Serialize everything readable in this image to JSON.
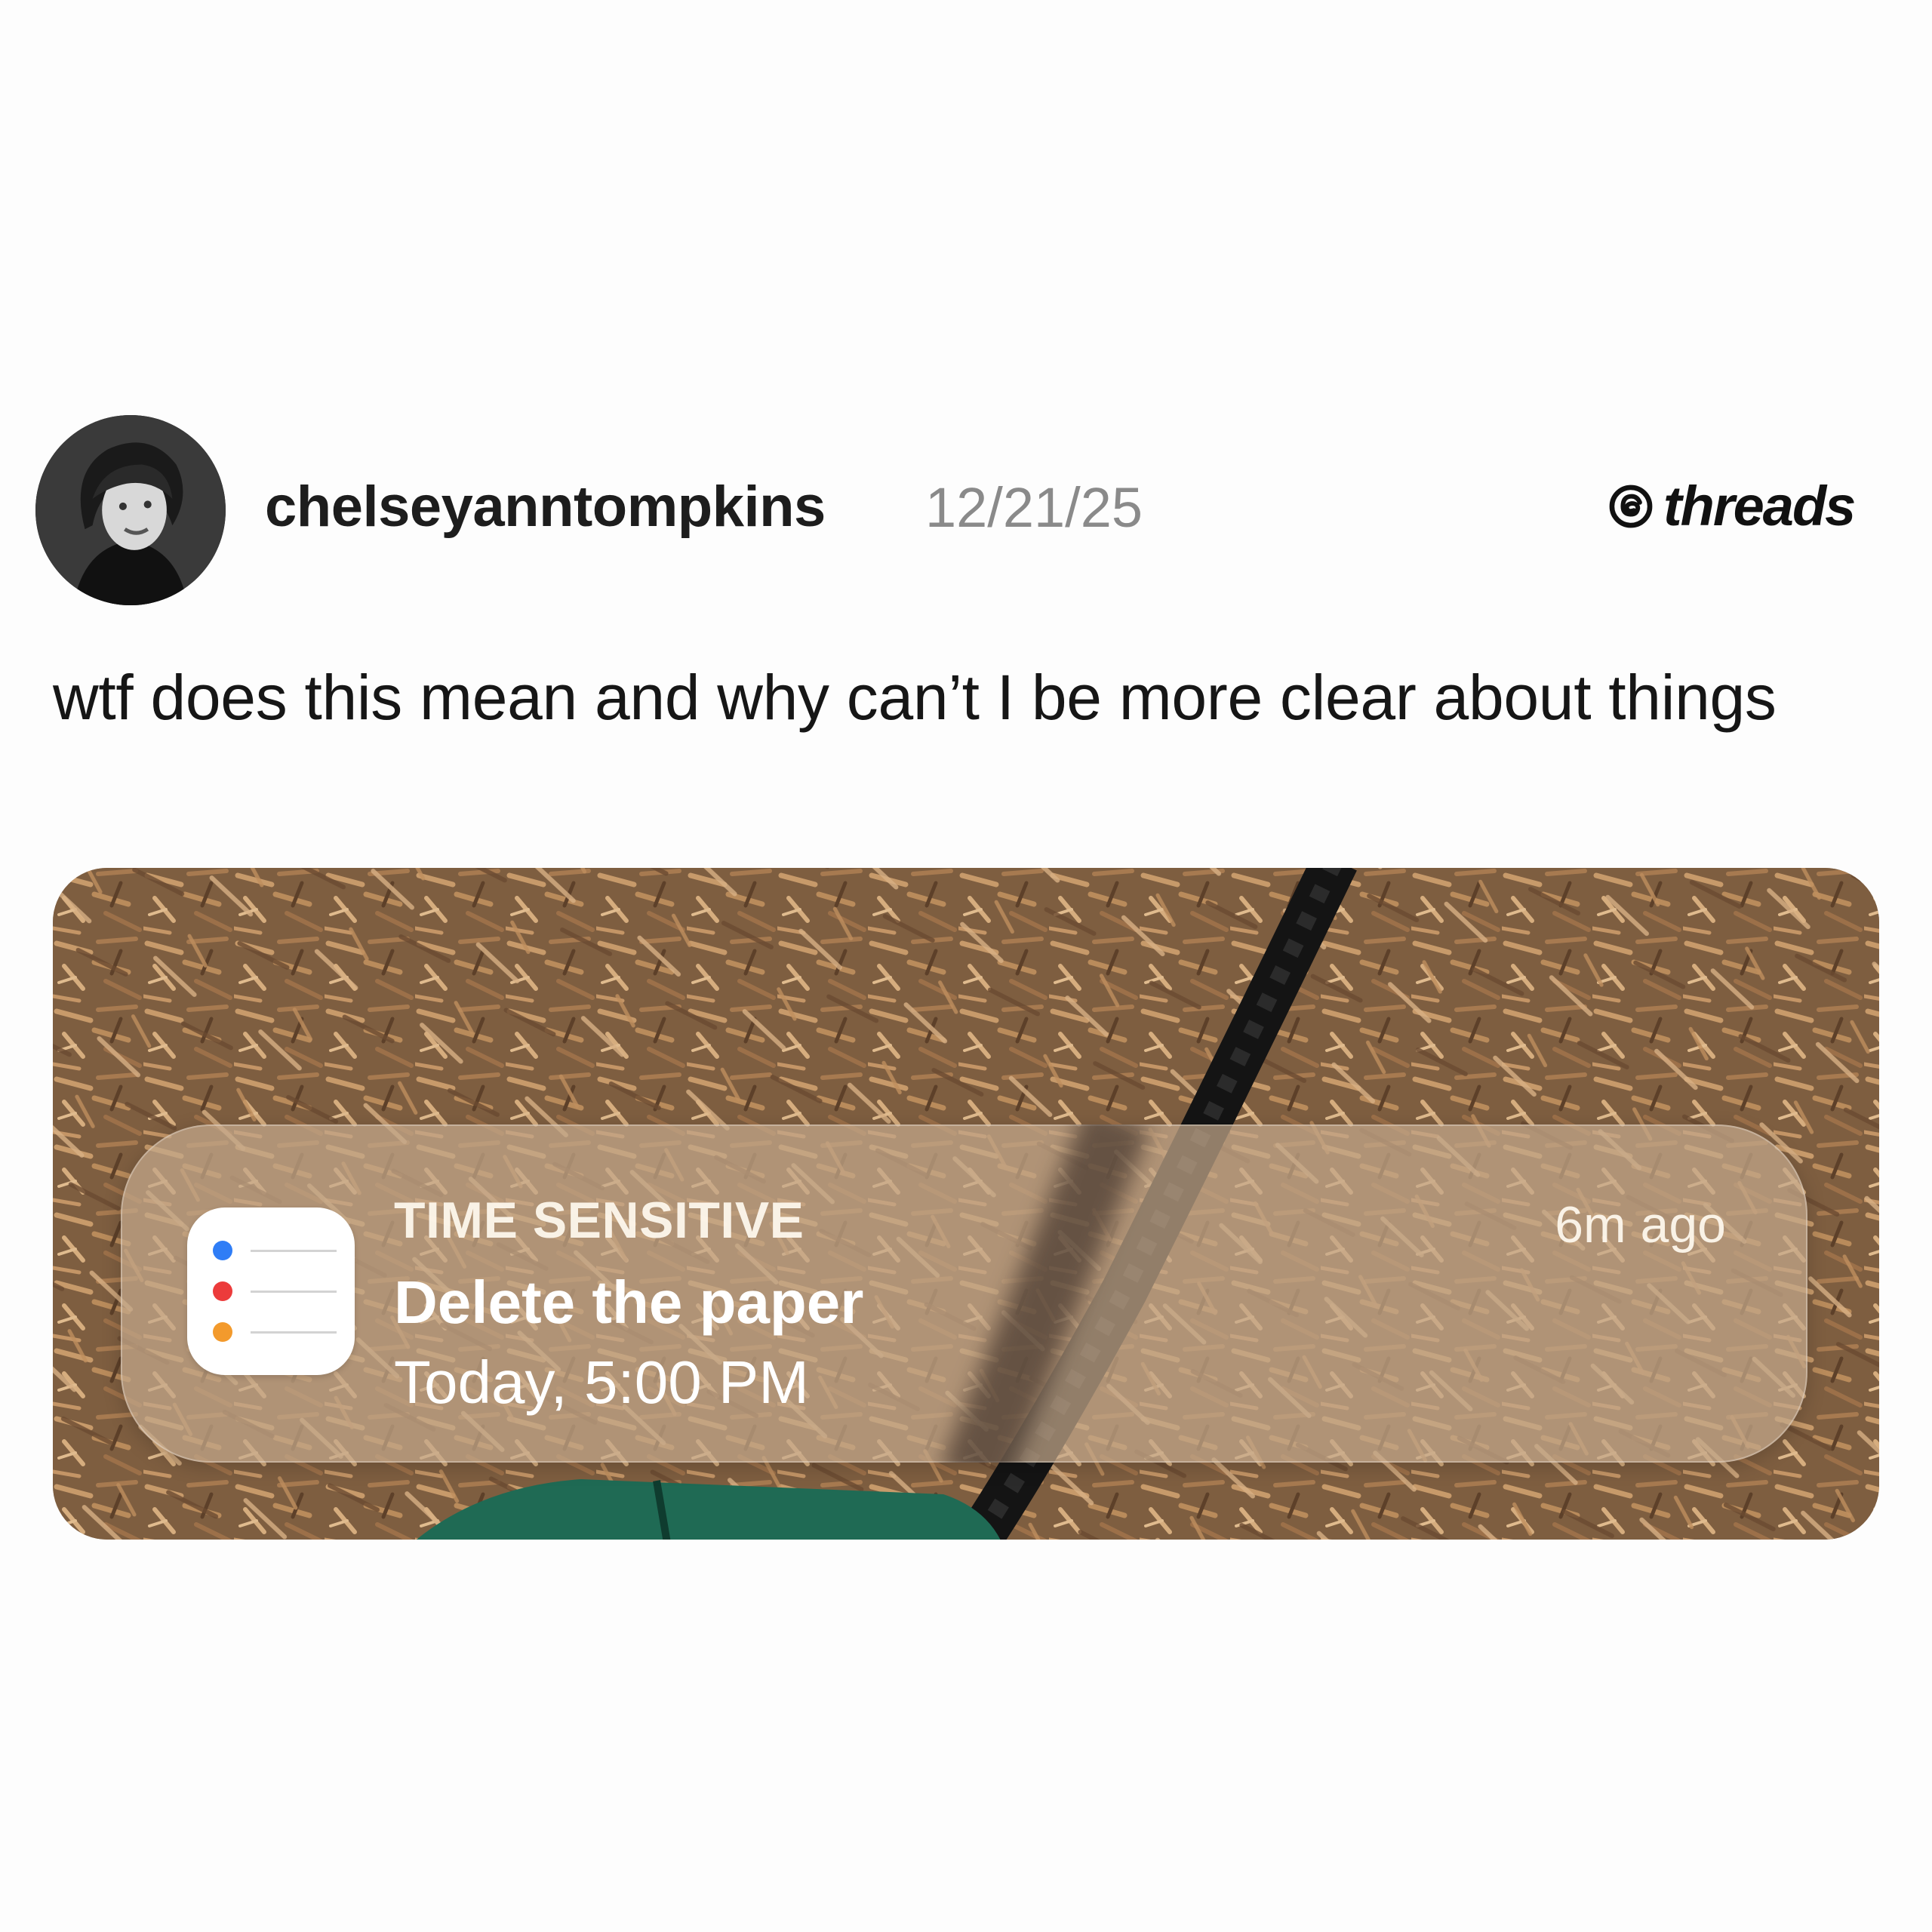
{
  "post": {
    "username": "chelseyanntompkins",
    "date": "12/21/25",
    "brand": "threads",
    "caption": "wtf does this mean and why can’t I be more clear about things"
  },
  "icons": {
    "avatar": "profile-photo",
    "brand_icon": "threads-logo-icon",
    "app_icon": "reminders-app-icon"
  },
  "notification": {
    "kicker": "TIME SENSITIVE",
    "title": "Delete the paper",
    "subtitle": "Today, 5:00 PM",
    "time_ago": "6m ago"
  },
  "colors": {
    "background": "#fdfdfd",
    "text": "#161616",
    "date_gray": "#8a8a8a",
    "mulch_brown": "#8a6a4c",
    "swing_green": "#1f6a54",
    "reminder_blue": "#2f7df6",
    "reminder_red": "#ec3b3b",
    "reminder_orange": "#f39a2c"
  }
}
